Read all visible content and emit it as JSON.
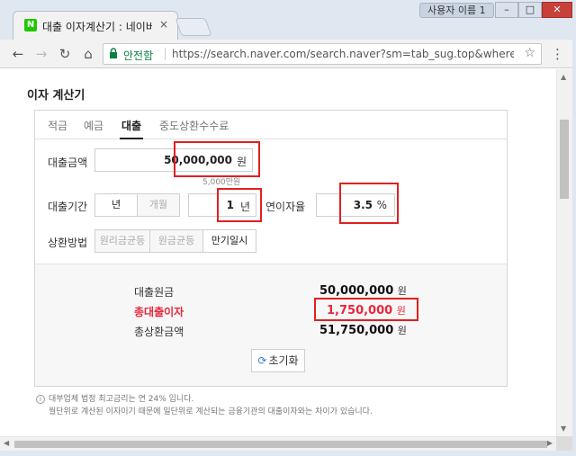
{
  "browser": {
    "tab_title": "대출 이자계산기 : 네이버",
    "tab_close": "×",
    "favicon_letter": "N",
    "profile_name": "사용자 이름 1",
    "secure_label": "안전함",
    "url": "https://search.naver.com/search.naver?sm=tab_sug.top&where=n...",
    "min_label": "–",
    "max_label": "□",
    "close_label": "✕"
  },
  "calculator": {
    "title": "이자 계산기",
    "tabs": [
      "적금",
      "예금",
      "대출",
      "중도상환수수료"
    ],
    "active_tab": "대출",
    "amount_label": "대출금액",
    "amount_value": "50,000,000",
    "amount_unit": "원",
    "amount_hint": "5,000만원",
    "period_label": "대출기간",
    "period_unit_year": "년",
    "period_unit_month": "개월",
    "period_value": "1",
    "period_value_unit": "년",
    "rate_label": "연이자율",
    "rate_value": "3.5",
    "rate_unit": "%",
    "repay_label": "상환방법",
    "repay_options": [
      "원리금균등",
      "원금균등",
      "만기일시"
    ],
    "repay_selected": "만기일시",
    "results": {
      "principal_label": "대출원금",
      "principal_value": "50,000,000",
      "interest_label": "총대출이자",
      "interest_value": "1,750,000",
      "total_label": "총상환금액",
      "total_value": "51,750,000",
      "unit": "원"
    },
    "reset_label": "초기화",
    "notes": [
      "대부업체 법정 최고금리는 연 24% 입니다.",
      "월단위로 계산된 이자이기 때문에 일단위로 계산되는 금융기관의 대출이자와는 차이가 있습니다."
    ]
  },
  "colors": {
    "highlight_red": "#e02020",
    "interest_red": "#e8283c",
    "naver_green": "#1ec800",
    "secure_green": "#0b8043"
  }
}
